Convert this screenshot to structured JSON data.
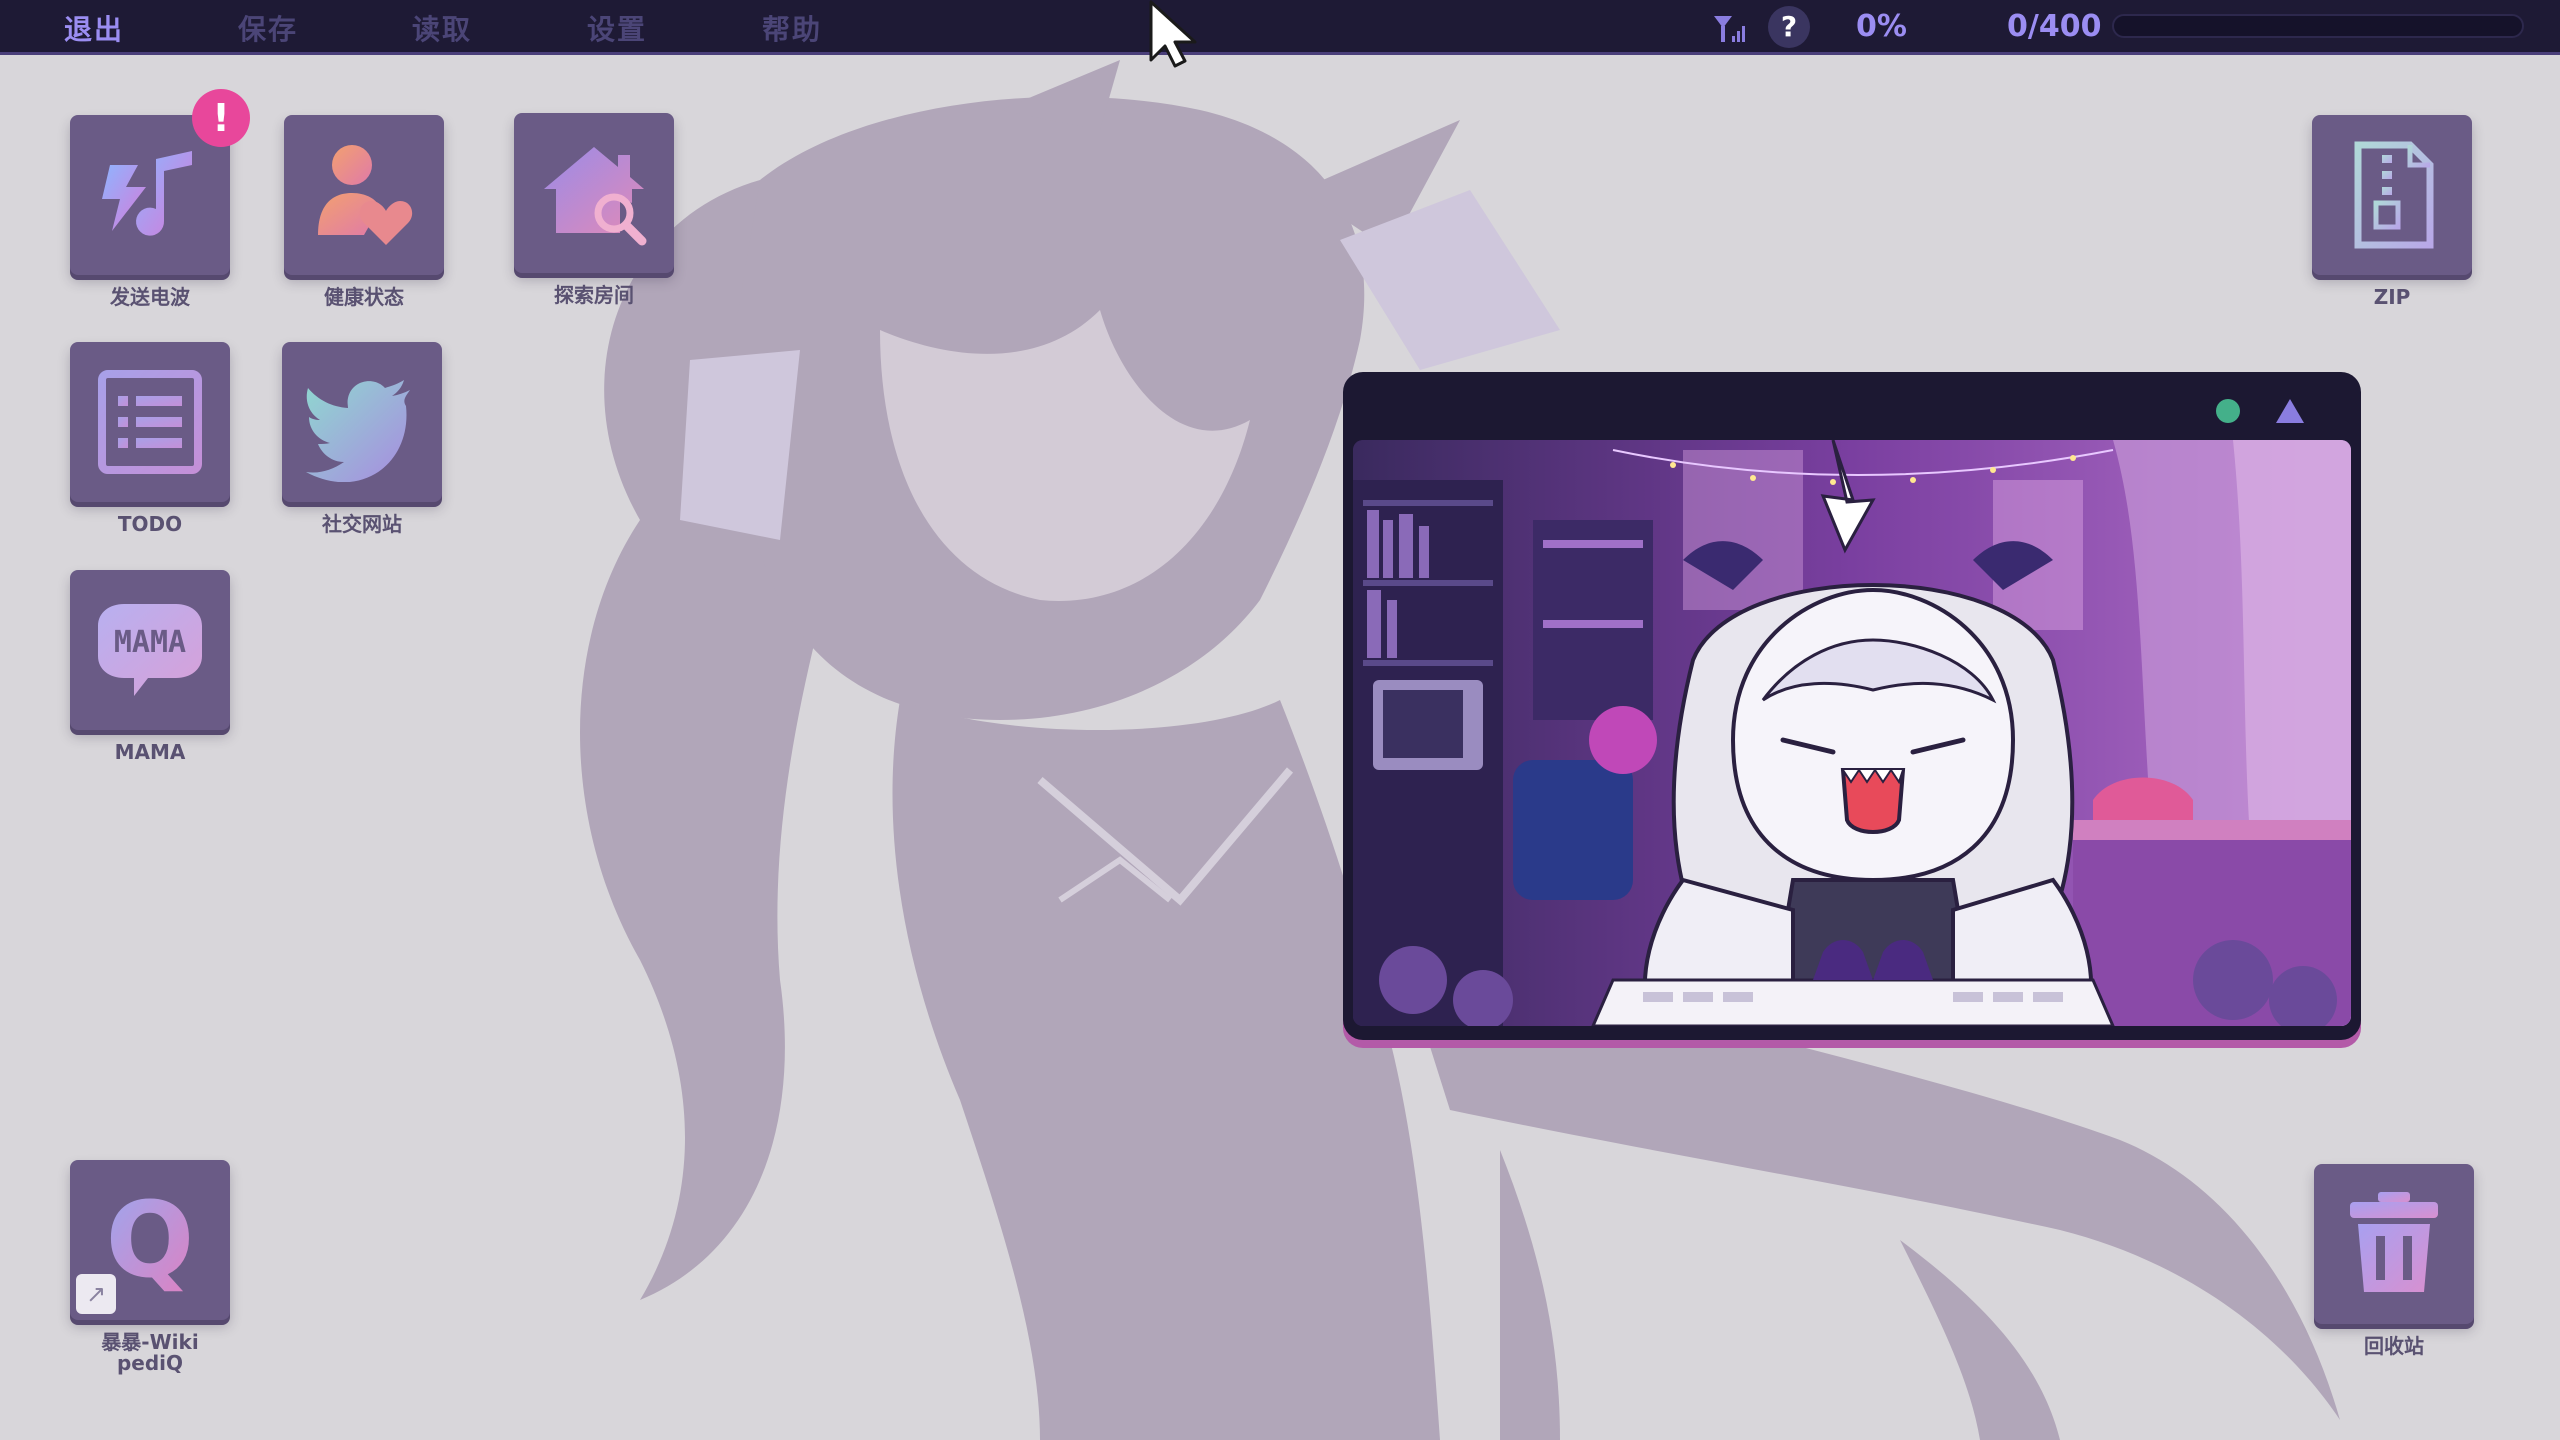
{
  "menu": {
    "items": [
      {
        "label": "退出",
        "active": true
      },
      {
        "label": "保存",
        "active": false
      },
      {
        "label": "读取",
        "active": false
      },
      {
        "label": "设置",
        "active": false
      },
      {
        "label": "帮助",
        "active": false
      }
    ]
  },
  "status": {
    "signal_icon": "signal-icon",
    "help_label": "?",
    "percent_label": "0%",
    "followers_label": "0/400",
    "progress_fraction": 0
  },
  "desktop": {
    "icons": [
      {
        "name": "send-wave",
        "label": "发送电波",
        "icon": "music-note-bolt-icon",
        "badge": "!"
      },
      {
        "name": "health-status",
        "label": "健康状态",
        "icon": "person-heart-icon"
      },
      {
        "name": "explore-room",
        "label": "探索房间",
        "icon": "house-search-icon"
      },
      {
        "name": "todo",
        "label": "TODO",
        "icon": "list-icon"
      },
      {
        "name": "social-site",
        "label": "社交网站",
        "icon": "bird-icon"
      },
      {
        "name": "mama",
        "label": "MAMA",
        "icon": "chat-bubble-icon",
        "icon_text": "MAMA"
      },
      {
        "name": "zip",
        "label": "ZIP",
        "icon": "zip-file-icon"
      },
      {
        "name": "wiki",
        "label_line1": "暴暴-Wiki",
        "label_line2": "pediQ",
        "icon": "q-letter-icon",
        "icon_text": "Q",
        "shortcut": "↗"
      },
      {
        "name": "recycle-bin",
        "label": "回收站",
        "icon": "trash-icon"
      }
    ]
  },
  "window": {
    "status_color": "#44b08a",
    "accent_color": "#b35aa8"
  },
  "colors": {
    "menubar": "#1e1a35",
    "menu_active": "#9b8df2",
    "menu_inactive": "#4b4577",
    "tile": "#6a5b86",
    "badge": "#e8479b"
  }
}
